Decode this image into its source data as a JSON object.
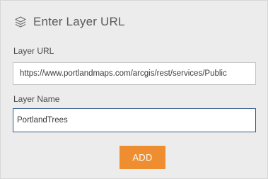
{
  "dialog": {
    "icon": "layers-icon",
    "title": "Enter Layer URL"
  },
  "layer_url": {
    "label": "Layer URL",
    "value": "https://www.portlandmaps.com/arcgis/rest/services/Public"
  },
  "layer_name": {
    "label": "Layer Name",
    "value": "PortlandTrees"
  },
  "actions": {
    "add_label": "ADD"
  },
  "colors": {
    "panel_background": "#ececec",
    "accent_button": "#ef8e30",
    "focused_border": "#2e5b8c"
  }
}
